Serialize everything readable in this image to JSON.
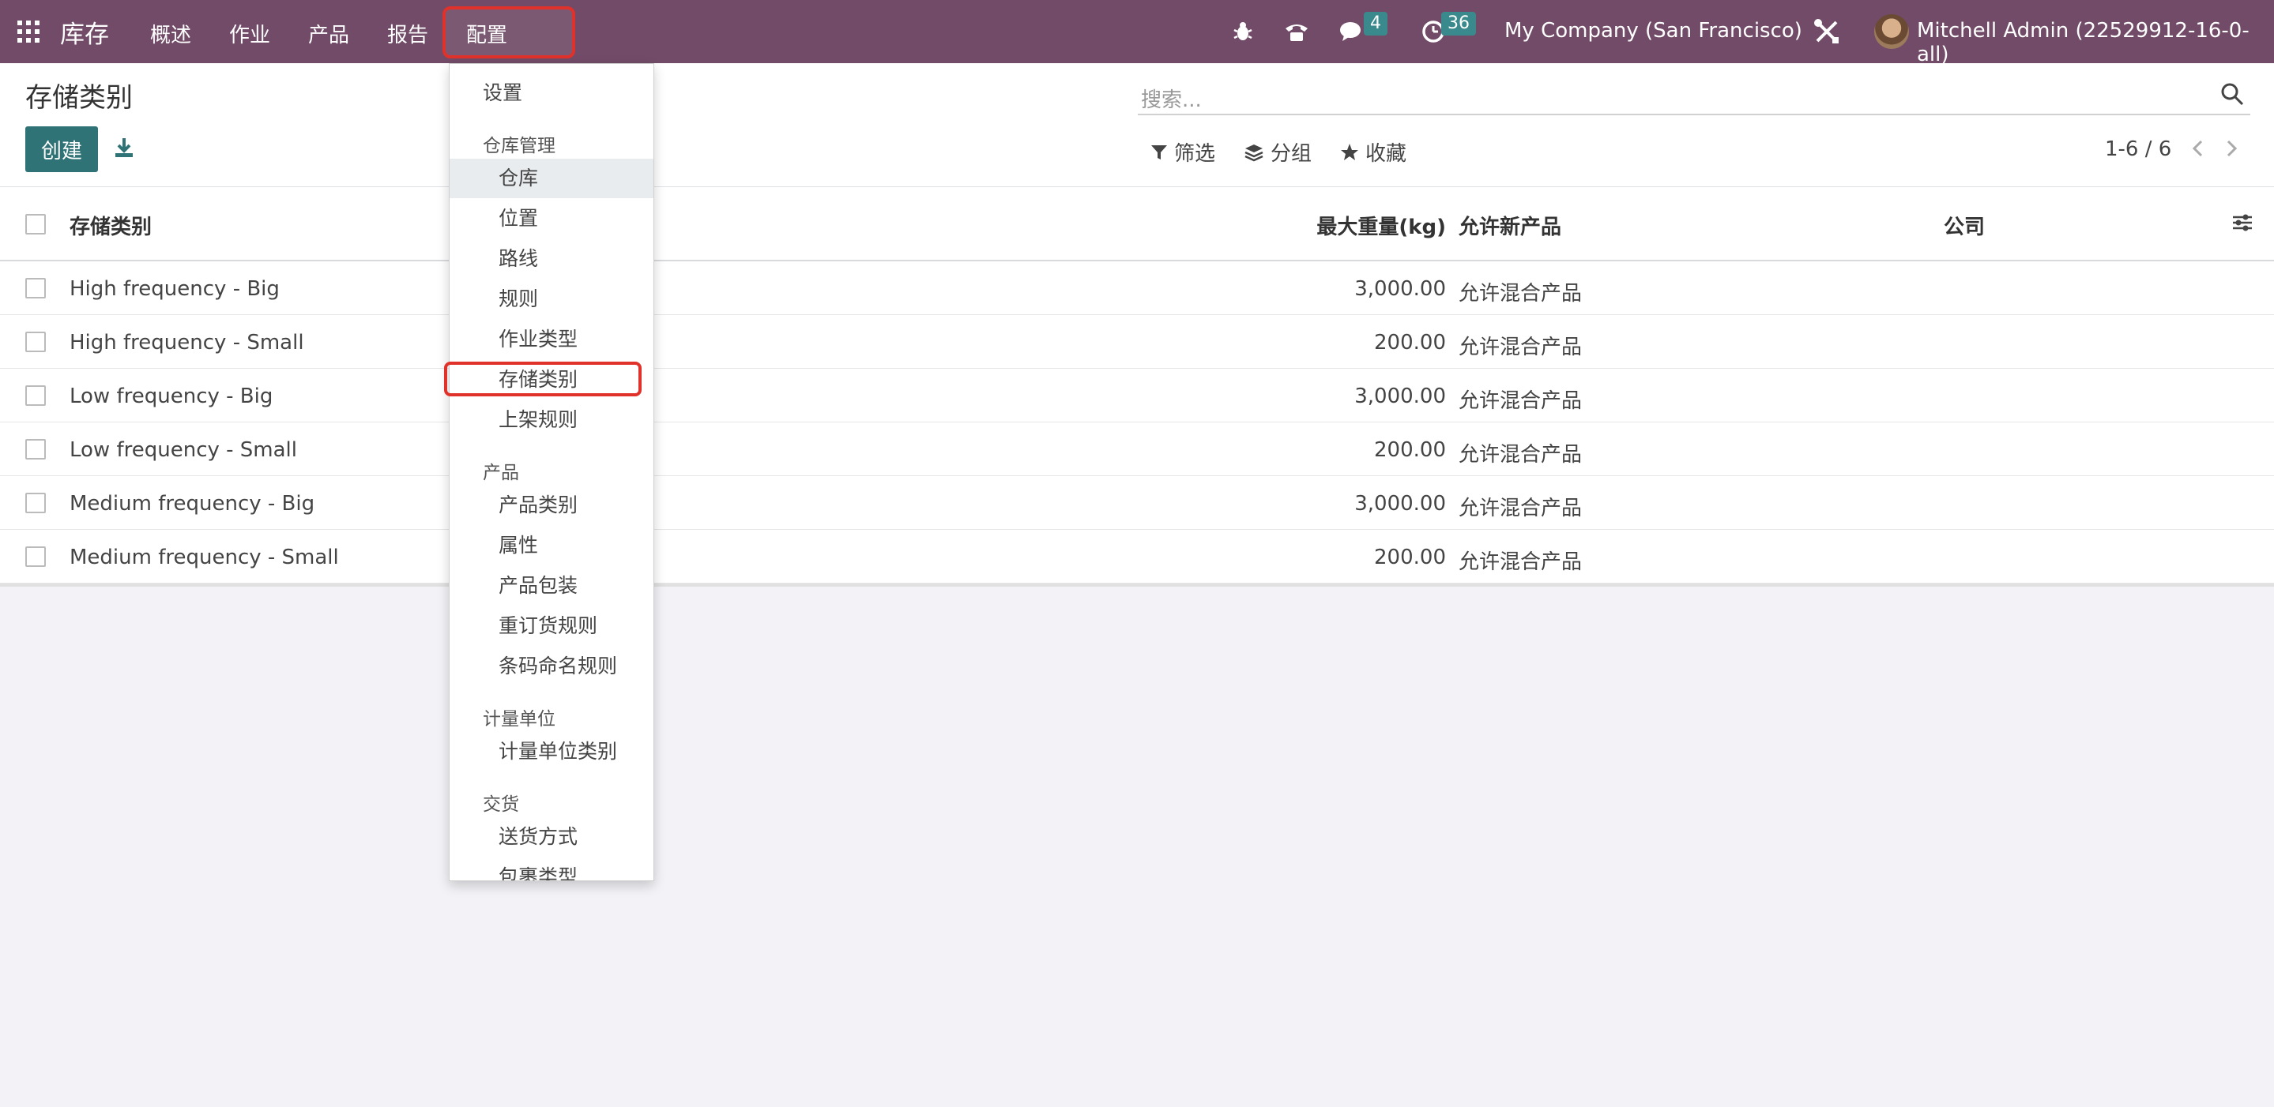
{
  "navbar": {
    "app_name": "库存",
    "menu": [
      "概述",
      "作业",
      "产品",
      "报告",
      "配置"
    ],
    "messages_count": "4",
    "activities_count": "36",
    "company": "My Company (San Francisco)",
    "user": "Mitchell Admin (22529912-16-0-all)"
  },
  "control": {
    "title": "存储类别",
    "create_label": "创建",
    "search_placeholder": "搜索...",
    "filter_label": "筛选",
    "group_label": "分组",
    "favorites_label": "收藏",
    "pager": "1-6 / 6"
  },
  "list": {
    "headers": {
      "name": "存储类别",
      "max_weight": "最大重量(kg)",
      "allow_new": "允许新产品",
      "company": "公司"
    },
    "rows": [
      {
        "name": "High frequency - Big",
        "max_weight": "3,000.00",
        "allow_new": "允许混合产品",
        "company": ""
      },
      {
        "name": "High frequency - Small",
        "max_weight": "200.00",
        "allow_new": "允许混合产品",
        "company": ""
      },
      {
        "name": "Low frequency - Big",
        "max_weight": "3,000.00",
        "allow_new": "允许混合产品",
        "company": ""
      },
      {
        "name": "Low frequency - Small",
        "max_weight": "200.00",
        "allow_new": "允许混合产品",
        "company": ""
      },
      {
        "name": "Medium frequency - Big",
        "max_weight": "3,000.00",
        "allow_new": "允许混合产品",
        "company": ""
      },
      {
        "name": "Medium frequency - Small",
        "max_weight": "200.00",
        "allow_new": "允许混合产品",
        "company": ""
      }
    ]
  },
  "dropdown": {
    "settings": "设置",
    "section_warehouse": "仓库管理",
    "warehouse_items": [
      "仓库",
      "位置",
      "路线",
      "规则",
      "作业类型",
      "存储类别",
      "上架规则"
    ],
    "section_products": "产品",
    "product_items": [
      "产品类别",
      "属性",
      "产品包装",
      "重订货规则",
      "条码命名规则"
    ],
    "section_uom": "计量单位",
    "uom_items": [
      "计量单位类别"
    ],
    "section_delivery": "交货",
    "delivery_items": [
      "送货方式",
      "包裹类型"
    ]
  },
  "colors": {
    "navbar": "#714b67",
    "primary": "#2f7377",
    "highlight": "#e0312a"
  }
}
